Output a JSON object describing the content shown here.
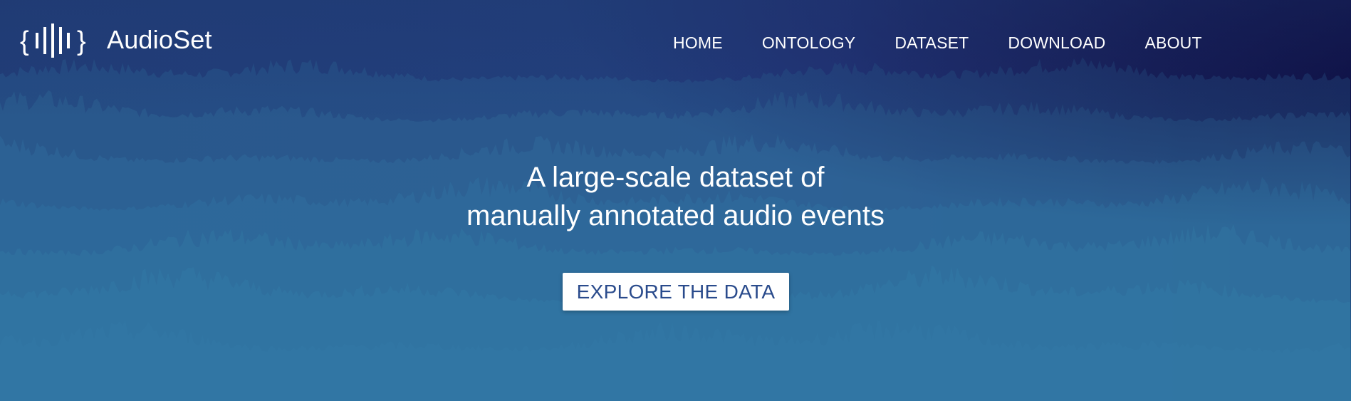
{
  "brand": {
    "name": "AudioSet",
    "logo_icon": "audio-bars-braces-icon"
  },
  "nav": {
    "items": [
      {
        "label": "HOME"
      },
      {
        "label": "ONTOLOGY"
      },
      {
        "label": "DATASET"
      },
      {
        "label": "DOWNLOAD"
      },
      {
        "label": "ABOUT"
      }
    ]
  },
  "hero": {
    "tagline_line1": "A large-scale dataset of",
    "tagline_line2": "manually annotated audio events",
    "cta_label": "EXPLORE THE DATA"
  },
  "colors": {
    "background_left": "#213d78",
    "background_right": "#0f1248",
    "wave_light": "#2f6c9c",
    "text": "#ffffff",
    "cta_background": "#ffffff",
    "cta_text": "#2a4b8c"
  }
}
